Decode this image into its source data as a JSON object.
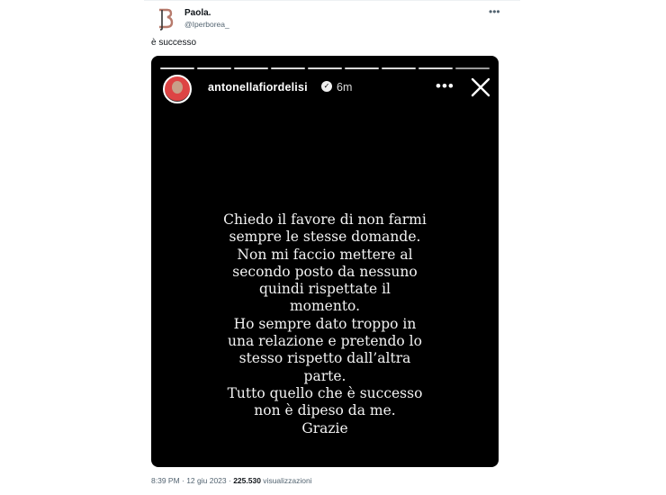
{
  "tweet": {
    "author_name": "Paola.",
    "author_handle": "@Iperborea_",
    "text": "è successo",
    "more_icon": "more-horizontal-icon",
    "timestamp": "8:39 PM · 12 giu 2023 · ",
    "views_count": "225.530",
    "views_label": " visualizzazioni"
  },
  "story": {
    "username": "antonellafiordelisi",
    "time_ago": "6m",
    "segments_total": 9,
    "text": "Chiedo il favore di non farmi\nsempre le stesse domande.\nNon mi faccio mettere al\nsecondo posto da nessuno\nquindi rispettate il\nmomento.\nHo sempre dato troppo in\nuna relazione e pretendo lo\nstesso rispetto dall’altra\nparte.\nTutto quello che è successo\nnon è dipeso da me.\nGrazie"
  }
}
